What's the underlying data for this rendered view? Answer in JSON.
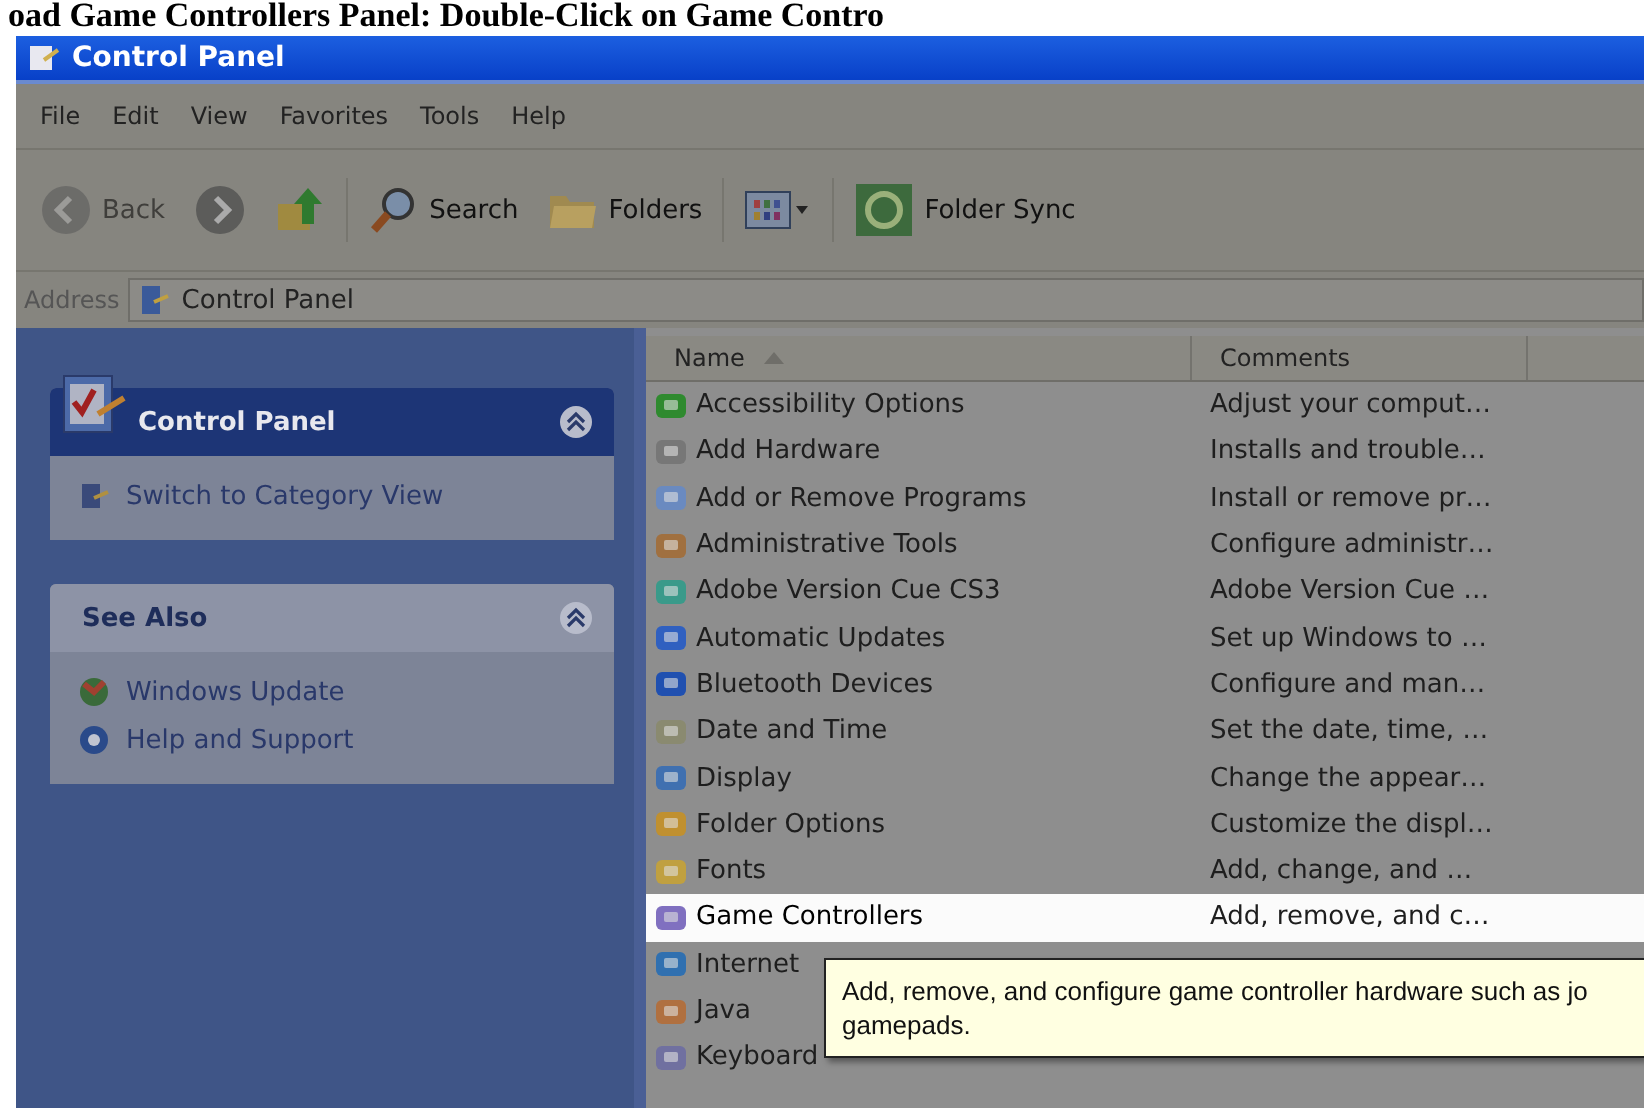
{
  "caption": "oad Game Controllers Panel: Double-Click on Game Contro",
  "window": {
    "title": "Control Panel"
  },
  "menu": [
    "File",
    "Edit",
    "View",
    "Favorites",
    "Tools",
    "Help"
  ],
  "toolbar": [
    {
      "kind": "back",
      "label": "Back",
      "disabled": true
    },
    {
      "kind": "forward",
      "disabled": false
    },
    {
      "kind": "up",
      "disabled": false
    },
    {
      "kind": "search",
      "label": "Search",
      "disabled": false
    },
    {
      "kind": "folders",
      "label": "Folders",
      "disabled": false
    },
    {
      "kind": "views",
      "disabled": false
    },
    {
      "kind": "sync",
      "label": "Folder Sync",
      "disabled": false
    }
  ],
  "address": {
    "label": "Address",
    "value": "Control Panel"
  },
  "sidebar": [
    {
      "title": "Control Panel",
      "kind": "primary",
      "items": [
        "Switch to Category View"
      ]
    },
    {
      "title": "See Also",
      "kind": "plain",
      "items": [
        "Windows Update",
        "Help and Support"
      ]
    }
  ],
  "table": {
    "columns": [
      "Name",
      "Comments"
    ],
    "rows": [
      {
        "name": "Accessibility Options",
        "comment": "Adjust your comput…",
        "selected": false
      },
      {
        "name": "Add Hardware",
        "comment": "Installs and trouble…",
        "selected": false
      },
      {
        "name": "Add or Remove Programs",
        "comment": "Install or remove pr…",
        "selected": false
      },
      {
        "name": "Administrative Tools",
        "comment": "Configure administr…",
        "selected": false
      },
      {
        "name": "Adobe Version Cue CS3",
        "comment": "Adobe Version Cue …",
        "selected": false
      },
      {
        "name": "Automatic Updates",
        "comment": "Set up Windows to …",
        "selected": false
      },
      {
        "name": "Bluetooth Devices",
        "comment": "Configure and man…",
        "selected": false
      },
      {
        "name": "Date and Time",
        "comment": "Set the date, time, …",
        "selected": false
      },
      {
        "name": "Display",
        "comment": "Change the appear…",
        "selected": false
      },
      {
        "name": "Folder Options",
        "comment": "Customize the displ…",
        "selected": false
      },
      {
        "name": "Fonts",
        "comment": "Add, change, and …",
        "selected": false
      },
      {
        "name": "Game Controllers",
        "comment": "Add, remove, and c…",
        "selected": true
      },
      {
        "name": "Internet",
        "selected": false
      },
      {
        "name": "Java",
        "selected": false
      },
      {
        "name": "Keyboard",
        "selected": false
      }
    ]
  },
  "tooltip": [
    "Add, remove, and configure game controller hardware such as jo",
    "gamepads."
  ]
}
